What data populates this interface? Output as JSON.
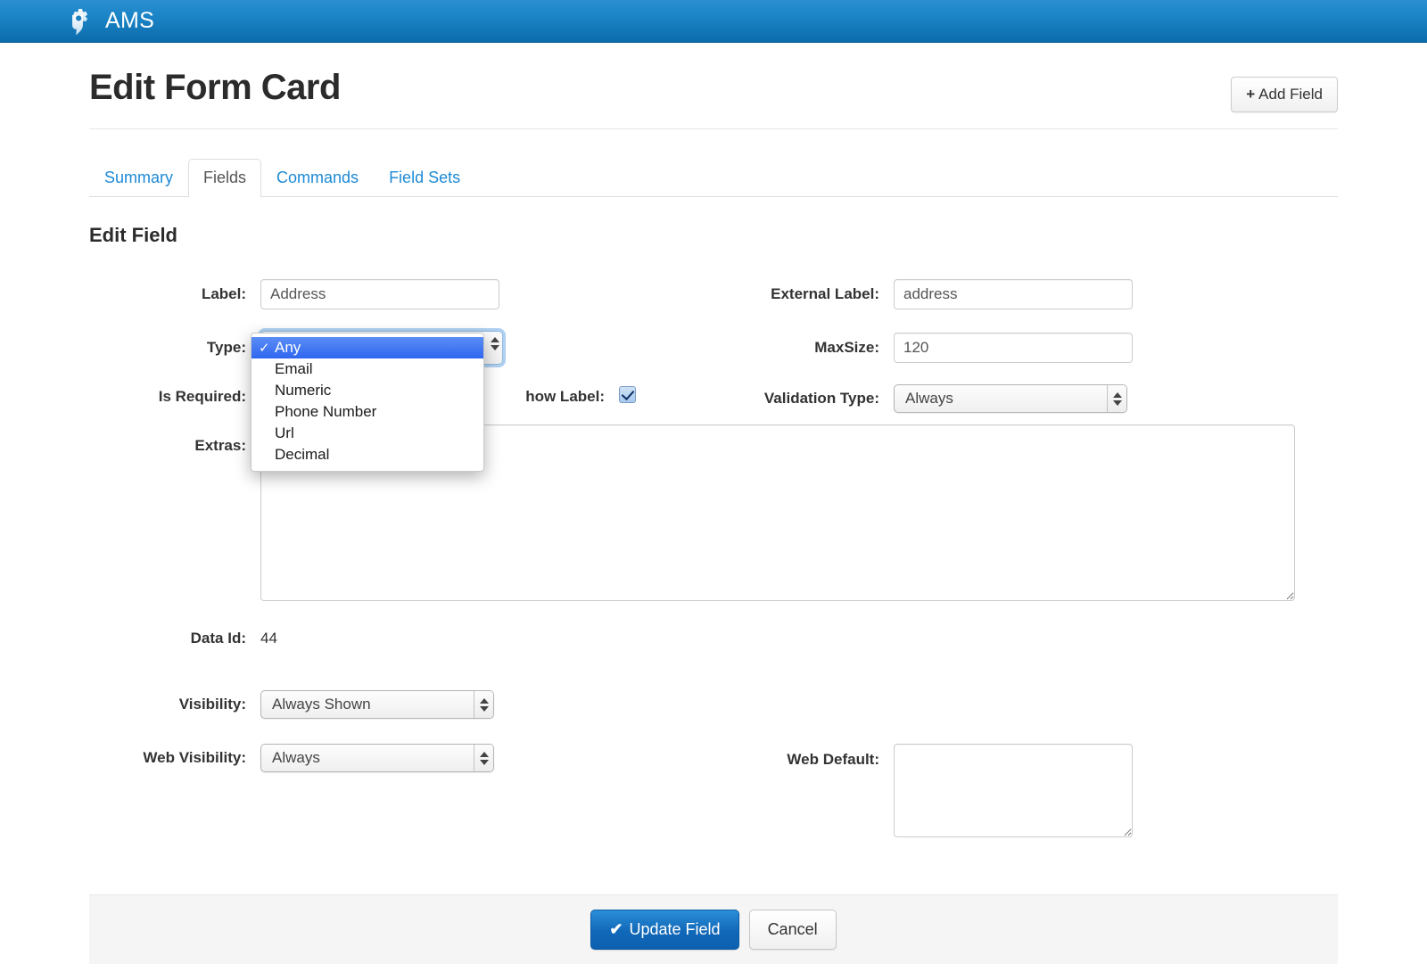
{
  "navbar": {
    "brand": "AMS",
    "icon": "gear-icon"
  },
  "page": {
    "title": "Edit Form Card",
    "add_field_button": "Add Field",
    "add_field_plus": "+"
  },
  "tabs": [
    {
      "label": "Summary",
      "active": false
    },
    {
      "label": "Fields",
      "active": true
    },
    {
      "label": "Commands",
      "active": false
    },
    {
      "label": "Field Sets",
      "active": false
    }
  ],
  "form": {
    "section_title": "Edit Field",
    "label": {
      "caption": "Label:",
      "value": "Address"
    },
    "external_label": {
      "caption": "External Label:",
      "value": "address"
    },
    "type": {
      "caption": "Type:",
      "value": "Any"
    },
    "maxsize": {
      "caption": "MaxSize:",
      "value": "120"
    },
    "is_required": {
      "caption": "Is Required:",
      "checked": false
    },
    "show_label": {
      "caption": "how Label:",
      "full_caption": "Show Label:",
      "checked": true
    },
    "validation_type": {
      "caption": "Validation Type:",
      "value": "Always"
    },
    "extras": {
      "caption": "Extras:",
      "value": ""
    },
    "data_id": {
      "caption": "Data Id:",
      "value": "44"
    },
    "visibility": {
      "caption": "Visibility:",
      "value": "Always Shown"
    },
    "web_visibility": {
      "caption": "Web Visibility:",
      "value": "Always"
    },
    "web_default": {
      "caption": "Web Default:",
      "value": ""
    }
  },
  "type_dropdown": {
    "open": true,
    "selected_index": 0,
    "check_glyph": "✓",
    "options": [
      "Any",
      "Email",
      "Numeric",
      "Phone Number",
      "Url",
      "Decimal"
    ]
  },
  "footer": {
    "update_button": "Update Field",
    "update_tick": "✔",
    "cancel_button": "Cancel"
  },
  "colors": {
    "navbar_top": "#2b8fd0",
    "navbar_bottom": "#0d6cab",
    "link": "#1e8ad6",
    "primary_button": "#1168b8",
    "dropdown_highlight": "#2f66ef"
  }
}
